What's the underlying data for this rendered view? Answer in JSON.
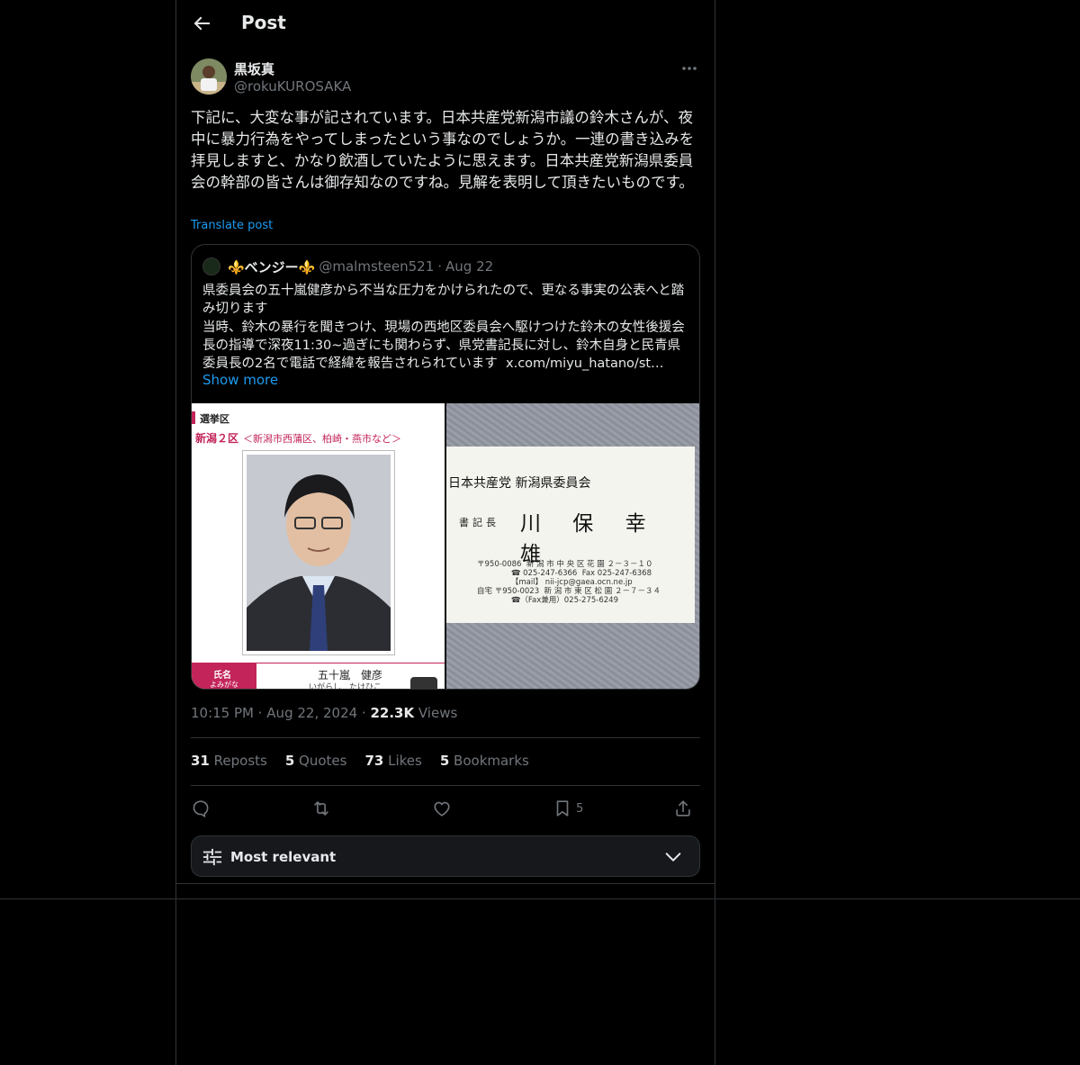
{
  "header": {
    "title": "Post"
  },
  "author": {
    "name": "黒坂真",
    "handle": "@rokuKUROSAKA"
  },
  "tweet": {
    "text": "下記に、大変な事が記されています。日本共産党新潟市議の鈴木さんが、夜中に暴力行為をやってしまったという事なのでしょうか。一連の書き込みを拝見しますと、かなり飲酒していたように思えます。日本共産党新潟県委員会の幹部の皆さんは御存知なのですね。見解を表明して頂きたいものです。",
    "translate_label": "Translate post"
  },
  "quote": {
    "name": "⚜️ベンジー⚜️",
    "handle": "@malmsteen521",
    "dot": "·",
    "date": "Aug 22",
    "text": "県委員会の五十嵐健彦から不当な圧力をかけられたので、更なる事実の公表へと踏み切ります\n当時、鈴木の暴行を聞きつけ、現場の西地区委員会へ駆けつけた鈴木の女性後援会長の指導で深夜11:30~過ぎにも関わらず、県党書記長に対し、鈴木自身と民青県委員長の2名で電話で経緯を報告されられています  x.com/miyu_hatano/st…",
    "show_more": "Show more",
    "image1": {
      "label": "選挙区",
      "district": "新潟２区",
      "area": "＜新潟市西蒲区、柏崎・燕市など＞",
      "name_label": "氏名",
      "kana_label": "よみがな",
      "name": "五十嵐　健彦",
      "kana": "いがらし　たけひこ"
    },
    "image2": {
      "org": "日本共産党 新潟県委員会",
      "title": "書記長",
      "name": "川 保 幸 雄",
      "address": "〒950-0086  新 潟 市 中 央 区 花 園 ２－３－１０\n              ☎ 025-247-6366  Fax 025-247-6368\n              【mail】 nii-jcp@gaea.ocn.ne.jp\n自宅 〒950-0023  新 潟 市 東 区 松 園 ２－７－３４\n              ☎（Fax兼用）025-275-6249"
    }
  },
  "meta": {
    "time": "10:15 PM",
    "dot": " · ",
    "date": "Aug 22, 2024",
    "views_count": "22.3K",
    "views_label": " Views"
  },
  "stats": [
    {
      "count": "31",
      "label": " Reposts"
    },
    {
      "count": "5",
      "label": " Quotes"
    },
    {
      "count": "73",
      "label": " Likes"
    },
    {
      "count": "5",
      "label": " Bookmarks"
    }
  ],
  "actions": {
    "bookmark_count": "5"
  },
  "sort": {
    "label": "Most relevant"
  }
}
